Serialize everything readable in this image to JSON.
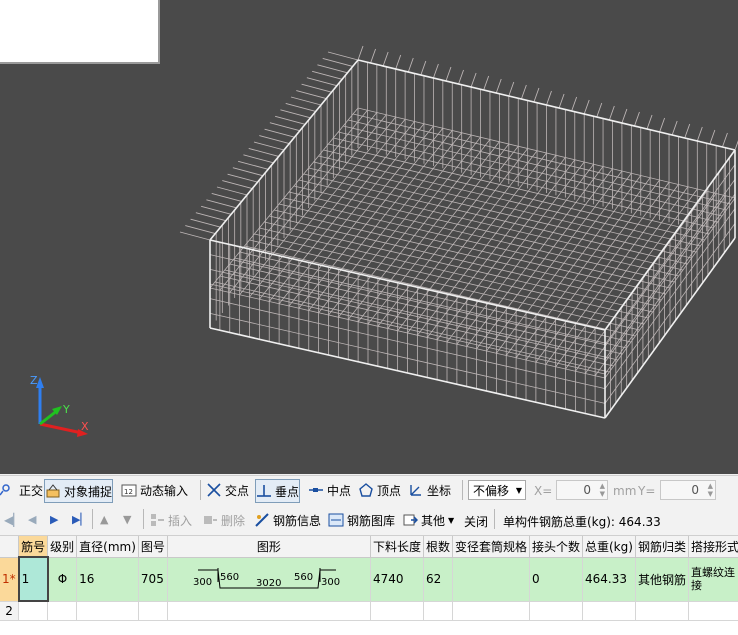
{
  "viewport": {
    "axis": {
      "z_label": "Z",
      "y_label": "Y",
      "x_label": "X"
    }
  },
  "toolbar1": {
    "ortho": "正交",
    "snap": "对象捕捉",
    "dyn_input": "动态输入",
    "intersection": "交点",
    "perpendicular": "垂点",
    "midpoint": "中点",
    "vertex": "顶点",
    "coordinate": "坐标",
    "offset_select": "不偏移",
    "x_label": "X=",
    "x_value": "0",
    "x_unit": "mm",
    "y_label": "Y=",
    "y_value": "0"
  },
  "toolbar2": {
    "insert": "插入",
    "delete": "删除",
    "rebar_info": "钢筋信息",
    "rebar_library": "钢筋图库",
    "other": "其他",
    "close": "关闭",
    "total_weight": "单构件钢筋总重(kg): 464.33"
  },
  "grid": {
    "columns": [
      "筋号",
      "级别",
      "直径(mm)",
      "图号",
      "图形",
      "下料长度",
      "根数",
      "变径套筒规格",
      "接头个数",
      "总重(kg)",
      "钢筋归类",
      "搭接形式"
    ],
    "rows": [
      {
        "hdr": "1*",
        "no": "1",
        "grade": "Φ",
        "diameter": "16",
        "fig_no": "705",
        "shape": {
          "a": "300",
          "b": "560",
          "c": "3020",
          "d": "560",
          "e": "300"
        },
        "cut_len": "4740",
        "count": "62",
        "sleeve": "",
        "joints": "0",
        "weight": "464.33",
        "category": "其他钢筋",
        "lap": "直螺纹连接"
      },
      {
        "hdr": "2"
      }
    ]
  },
  "colors": {
    "viewport_bg": "#4a4a4a",
    "selected_row": "#c8f0c8",
    "active_header": "#fbd99a"
  }
}
